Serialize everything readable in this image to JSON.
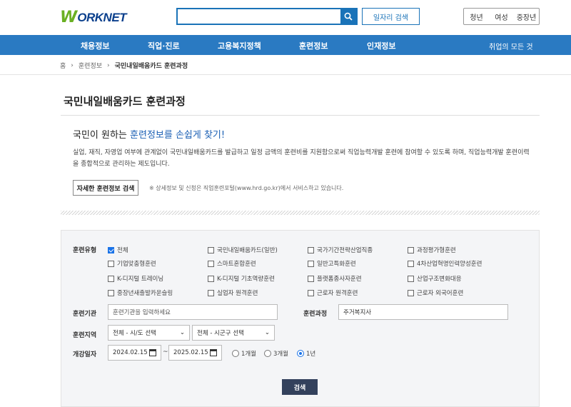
{
  "header": {
    "logo_mark": "W",
    "logo_text": "ORKNET",
    "search_placeholder": "",
    "job_search_label": "일자리 검색",
    "user_tabs": [
      "청년",
      "여성",
      "중장년"
    ]
  },
  "nav": {
    "items": [
      "채용정보",
      "직업·진로",
      "고용복지정책",
      "훈련정보",
      "인재정보"
    ],
    "all_menu": "취업의 모든 것"
  },
  "breadcrumb": [
    "홈",
    "훈련정보",
    "국민내일배움카드 훈련과정"
  ],
  "page": {
    "title": "국민내일배움카드 훈련과정",
    "intro_prefix": "국민이 원하는 ",
    "intro_highlight": "훈련정보를 손쉽게 찾기!",
    "intro_body": "실업, 재직, 자영업 여부에 관계없이 국민내일배움카드를 발급하고 일정 금액의 훈련비를 지원함으로써 직업능력개발 훈련에 참여할 수 있도록 하며, 직업능력개발 훈련이력을 종합적으로 관리하는 제도입니다.",
    "detail_button": "자세한 훈련정보 검색",
    "note": "※ 상세정보 및 신청은 직업훈련포털(www.hrd.go.kr)에서 서비스하고 있습니다."
  },
  "form": {
    "type_label": "훈련유형",
    "types": [
      {
        "label": "전체",
        "checked": true
      },
      {
        "label": "국민내일배움카드(일반)",
        "checked": false
      },
      {
        "label": "국가기간전략산업직종",
        "checked": false
      },
      {
        "label": "과정평가형훈련",
        "checked": false
      },
      {
        "label": "기업맞춤형훈련",
        "checked": false
      },
      {
        "label": "스마트혼합훈련",
        "checked": false
      },
      {
        "label": "일반고특화훈련",
        "checked": false
      },
      {
        "label": "4차산업혁명인력양성훈련",
        "checked": false
      },
      {
        "label": "K-디지털 트레이닝",
        "checked": false
      },
      {
        "label": "K-디지털 기초역량훈련",
        "checked": false
      },
      {
        "label": "플랫폼종사자훈련",
        "checked": false
      },
      {
        "label": "산업구조변화대응",
        "checked": false
      },
      {
        "label": "중장년새출발카운슬링",
        "checked": false
      },
      {
        "label": "실업자 원격훈련",
        "checked": false
      },
      {
        "label": "근로자 원격훈련",
        "checked": false
      },
      {
        "label": "근로자 외국어훈련",
        "checked": false
      }
    ],
    "institution_label": "훈련기관",
    "institution_placeholder": "훈련기관을 입력하세요",
    "course_label": "훈련과정",
    "course_value": "주거복지사",
    "region_label": "훈련지역",
    "region_sido": "전체 - 시/도 선택",
    "region_sigungu": "전체 - 시군구 선택",
    "date_label": "개강일자",
    "date_from": "2024.02.15",
    "date_sep": "~",
    "date_to": "2025.02.15",
    "periods": [
      {
        "label": "1개월",
        "checked": false
      },
      {
        "label": "3개월",
        "checked": false
      },
      {
        "label": "1년",
        "checked": true
      }
    ],
    "submit": "검색"
  }
}
